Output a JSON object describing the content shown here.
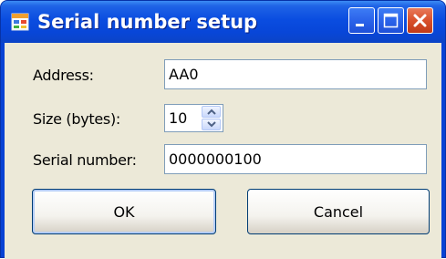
{
  "window": {
    "title": "Serial number setup",
    "icon": "app-window-icon",
    "buttons": [
      "minimize-icon",
      "maximize-icon",
      "close-icon"
    ]
  },
  "form": {
    "address_label": "Address:",
    "address_value": "AA0",
    "size_label": "Size (bytes):",
    "size_value": "10",
    "serial_label": "Serial number:",
    "serial_value": "0000000100"
  },
  "actions": {
    "ok_label": "OK",
    "cancel_label": "Cancel"
  },
  "colors": {
    "titlebar": "#0a4de0",
    "dialog_bg": "#ece9d8",
    "close_button": "#d9502c"
  }
}
